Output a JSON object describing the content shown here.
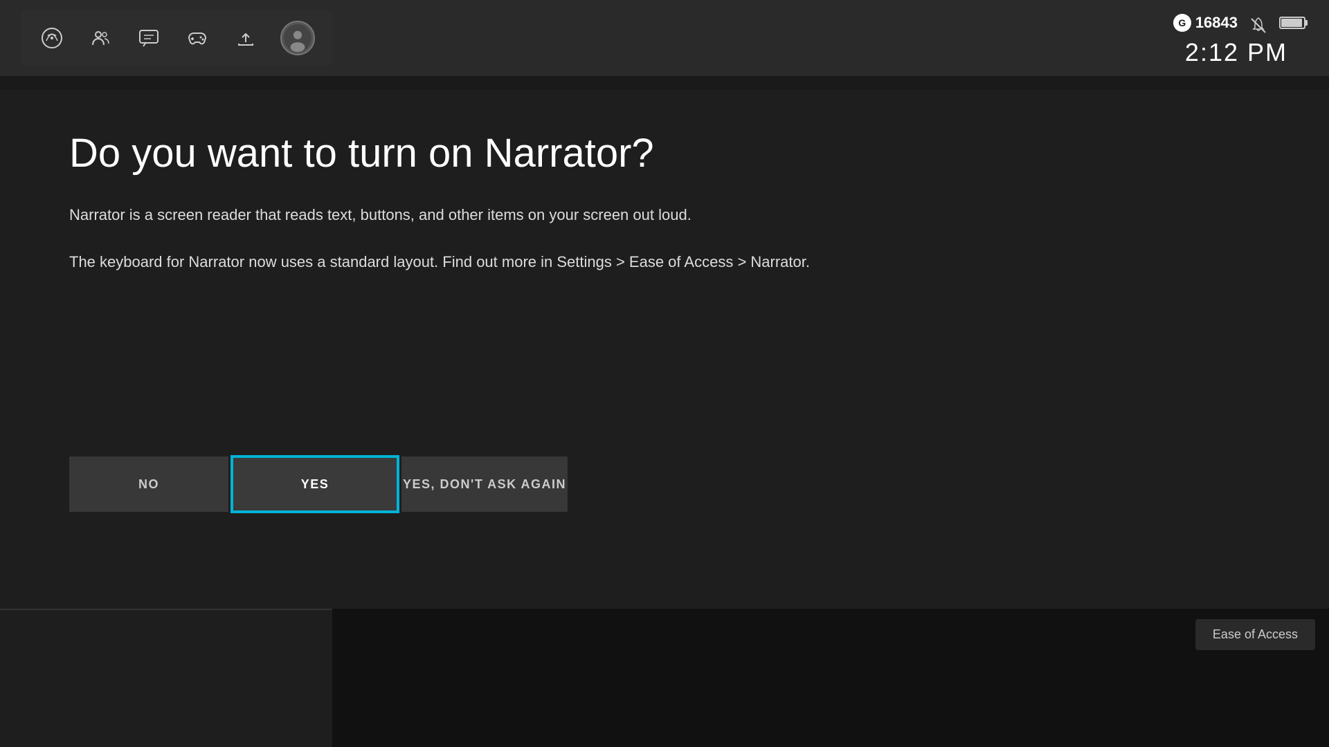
{
  "topbar": {
    "gamerscore_icon": "G",
    "gamerscore_value": "16843",
    "time": "2:12 PM"
  },
  "dialog": {
    "title": "Do you want to turn on Narrator?",
    "description": "Narrator is a screen reader that reads text, buttons, and other items on your screen out loud.",
    "info": "The keyboard for Narrator now uses a standard layout. Find out more in Settings > Ease of Access > Narrator."
  },
  "buttons": {
    "no_label": "NO",
    "yes_label": "YES",
    "yes_dont_label": "YES, DON'T ASK AGAIN"
  },
  "bottom": {
    "ease_label": "Ease of Access"
  },
  "colors": {
    "accent": "#00b4d8",
    "bg_dark": "#1a1a1a",
    "bg_mid": "#2a2a2a",
    "text_primary": "#ffffff",
    "text_secondary": "#dddddd"
  }
}
